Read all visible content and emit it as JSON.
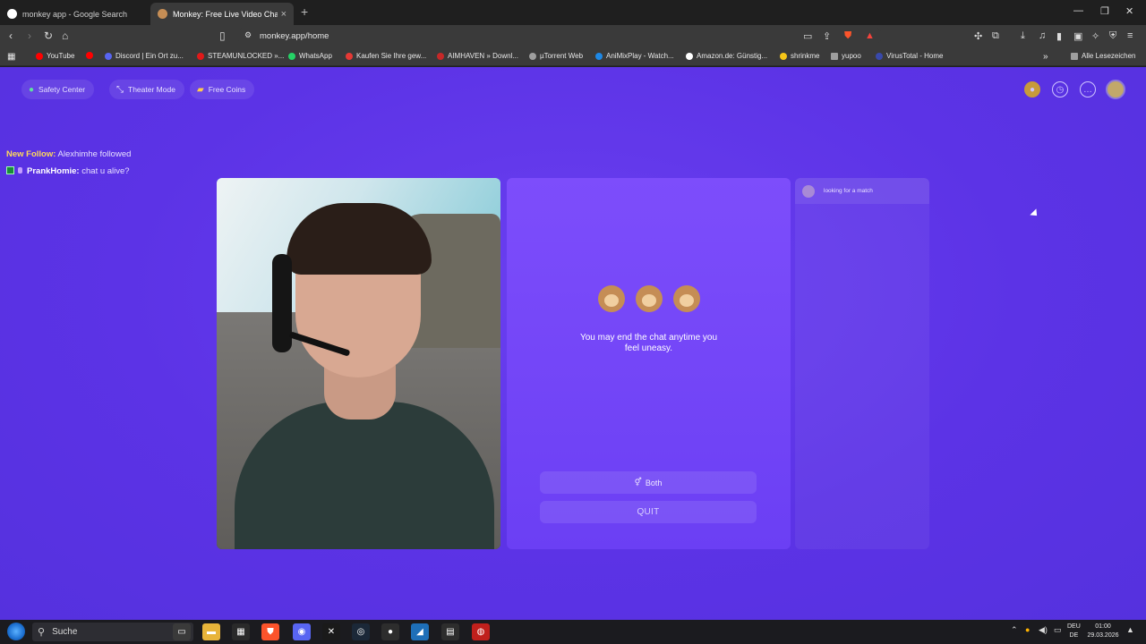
{
  "browser": {
    "tabs": [
      {
        "title": "monkey app - Google Search"
      },
      {
        "title": "Monkey: Free Live Video Chat"
      }
    ],
    "url": "monkey.app/home",
    "bookmarks": [
      {
        "label": "YouTube",
        "color": "#ff0000"
      },
      {
        "label": "",
        "color": "#ff0000"
      },
      {
        "label": "Discord | Ein Ort zu...",
        "color": "#5865f2"
      },
      {
        "label": "STEAMUNLOCKED »...",
        "color": "#e11919"
      },
      {
        "label": "WhatsApp",
        "color": "#25d366"
      },
      {
        "label": "Kaufen Sie Ihre gew...",
        "color": "#e53935"
      },
      {
        "label": "AIMHAVEN » Downl...",
        "color": "#c62828"
      },
      {
        "label": "µTorrent Web",
        "color": "#9e9e9e"
      },
      {
        "label": "AniMixPlay - Watch...",
        "color": "#1e88e5"
      },
      {
        "label": "Amazon.de: Günstig...",
        "color": "#ffffff"
      },
      {
        "label": "shrinkme",
        "color": "#f5c518"
      },
      {
        "label": "yupoo",
        "color": "#9e9e9e"
      },
      {
        "label": "VirusTotal - Home",
        "color": "#3949ab"
      }
    ],
    "all_bookmarks": "Alle Lesezeichen"
  },
  "topnav": {
    "safety_center": "Safety Center",
    "theater_mode": "Theater Mode",
    "free_coins": "Free Coins"
  },
  "feed": {
    "follow_prefix": "New Follow:",
    "follow_text": "Alexhimhe followed",
    "chat_user": "PrankHomie:",
    "chat_text": "chat u alive?"
  },
  "panel": {
    "notice": "You may end the chat anytime you feel uneasy.",
    "both_label": "Both",
    "quit_label": "QUIT"
  },
  "chat": {
    "status": "looking for a match"
  },
  "taskbar": {
    "search_placeholder": "Suche",
    "lang_top": "DEU",
    "lang_bottom": "DE",
    "time": "01:00",
    "date": "29.03.2026"
  }
}
